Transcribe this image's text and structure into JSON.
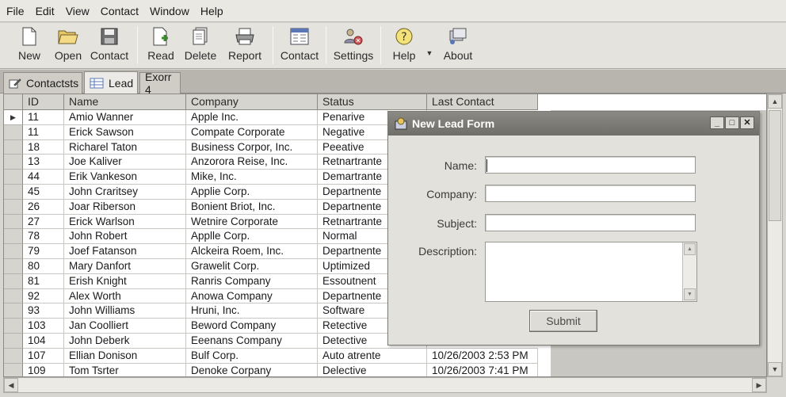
{
  "menu": [
    "File",
    "Edit",
    "View",
    "Contact",
    "Window",
    "Help"
  ],
  "toolbar": {
    "new": "New",
    "open": "Open",
    "contact1": "Contact",
    "read": "Read",
    "delete": "Delete",
    "report": "Report",
    "contact2": "Contact",
    "settings": "Settings",
    "help": "Help",
    "about": "About"
  },
  "tabs": [
    "Contactsts",
    "Lead",
    "Exorr 4"
  ],
  "columns": [
    "ID",
    "Name",
    "Company",
    "Status",
    "Last Contact"
  ],
  "rows": [
    [
      "11",
      "Amio Wanner",
      "Apple Inc.",
      "Penarive",
      ""
    ],
    [
      "11",
      "Erick Sawson",
      "Compate Corporate",
      "Negative",
      ""
    ],
    [
      "18",
      "Richarel Taton",
      "Business Corpor, Inc.",
      "Peeative",
      ""
    ],
    [
      "13",
      "Joe Kaliver",
      "Anzorora Reise, Inc.",
      "Retnartrante",
      ""
    ],
    [
      "44",
      "Erik Vankeson",
      "Mike, Inc.",
      "Demartrante",
      ""
    ],
    [
      "45",
      "John Craritsey",
      "Applie Corp.",
      "Departnente",
      ""
    ],
    [
      "26",
      "Joar Riberson",
      "Bonient Briot, Inc.",
      "Departnente",
      ""
    ],
    [
      "27",
      "Erick Warlson",
      "Wetnire Corporate",
      "Retnartrante",
      ""
    ],
    [
      "78",
      "John Robert",
      "Applle Corp.",
      "Normal",
      ""
    ],
    [
      "79",
      "Joef Fatanson",
      "Alckeira Roem, Inc.",
      "Departnente",
      ""
    ],
    [
      "80",
      "Mary Danfort",
      "Grawelit Corp.",
      "Uptimized",
      ""
    ],
    [
      "81",
      "Erish Knight",
      "Ranris Company",
      "Essoutnent",
      ""
    ],
    [
      "92",
      "Alex Worth",
      "Anowa Company",
      "Departnente",
      ""
    ],
    [
      "93",
      "John Williams",
      "Hruni, Inc.",
      "Software",
      ""
    ],
    [
      "103",
      "Jan Coolliert",
      "Beword Company",
      "Retective",
      ""
    ],
    [
      "104",
      "John Deberk",
      "Eeenans Company",
      "Detective",
      ""
    ],
    [
      "107",
      "Ellian Donison",
      "Bulf Corp.",
      "Auto atrente",
      "10/26/2003 2:53 PM"
    ],
    [
      "109",
      "Tom Tsrter",
      "Denoke Corpany",
      "Delective",
      "10/26/2003 7:41 PM"
    ]
  ],
  "dialog": {
    "title": "New Lead Form",
    "name_label": "Name:",
    "company_label": "Company:",
    "subject_label": "Subject:",
    "description_label": "Description:",
    "submit": "Submit",
    "name_value": "",
    "company_value": "",
    "subject_value": "",
    "description_value": ""
  },
  "colors": {
    "title_bar": "#777670",
    "selected_tab": "#ebeae6",
    "accent_blue": "#2f5fa8"
  }
}
